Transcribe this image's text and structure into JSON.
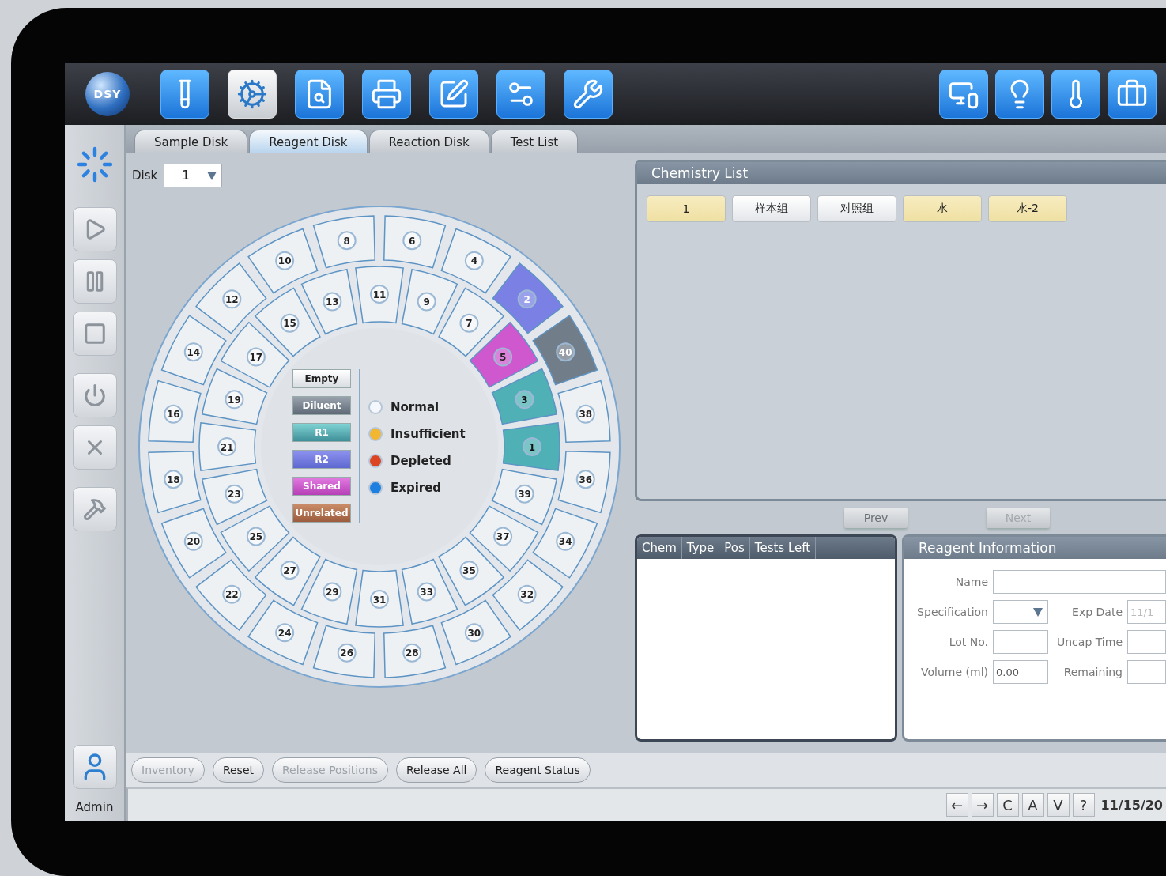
{
  "logo": {
    "text": "DSY"
  },
  "toolbar": [
    {
      "selected": false
    },
    {
      "selected": true
    },
    {
      "selected": false
    },
    {
      "selected": false
    },
    {
      "selected": false
    },
    {
      "selected": false
    },
    {
      "selected": false
    }
  ],
  "sidebar": {
    "user": "Admin"
  },
  "tabs": [
    {
      "label": "Sample Disk",
      "selected": false
    },
    {
      "label": "Reagent Disk",
      "selected": true
    },
    {
      "label": "Reaction Disk",
      "selected": false
    },
    {
      "label": "Test List",
      "selected": false
    }
  ],
  "disk": {
    "label": "Disk",
    "value": "1",
    "outer_ring": [
      {
        "number": "6",
        "kind": "empty"
      },
      {
        "number": "4",
        "kind": "empty"
      },
      {
        "number": "2",
        "kind": "r2"
      },
      {
        "number": "40",
        "kind": "diluent"
      },
      {
        "number": "38",
        "kind": "empty"
      },
      {
        "number": "36",
        "kind": "empty"
      },
      {
        "number": "34",
        "kind": "empty"
      },
      {
        "number": "32",
        "kind": "empty"
      },
      {
        "number": "30",
        "kind": "empty"
      },
      {
        "number": "28",
        "kind": "empty"
      },
      {
        "number": "26",
        "kind": "empty"
      },
      {
        "number": "24",
        "kind": "empty"
      },
      {
        "number": "22",
        "kind": "empty"
      },
      {
        "number": "20",
        "kind": "empty"
      },
      {
        "number": "18",
        "kind": "empty"
      },
      {
        "number": "16",
        "kind": "empty"
      },
      {
        "number": "14",
        "kind": "empty"
      },
      {
        "number": "12",
        "kind": "empty"
      },
      {
        "number": "10",
        "kind": "empty"
      },
      {
        "number": "8",
        "kind": "empty"
      }
    ],
    "inner_ring": [
      {
        "number": "11",
        "kind": "empty"
      },
      {
        "number": "9",
        "kind": "empty"
      },
      {
        "number": "7",
        "kind": "empty"
      },
      {
        "number": "5",
        "kind": "shared"
      },
      {
        "number": "3",
        "kind": "r1"
      },
      {
        "number": "1",
        "kind": "r1"
      },
      {
        "number": "39",
        "kind": "empty"
      },
      {
        "number": "37",
        "kind": "empty"
      },
      {
        "number": "35",
        "kind": "empty"
      },
      {
        "number": "33",
        "kind": "empty"
      },
      {
        "number": "31",
        "kind": "empty"
      },
      {
        "number": "29",
        "kind": "empty"
      },
      {
        "number": "27",
        "kind": "empty"
      },
      {
        "number": "25",
        "kind": "empty"
      },
      {
        "number": "23",
        "kind": "empty"
      },
      {
        "number": "21",
        "kind": "empty"
      },
      {
        "number": "19",
        "kind": "empty"
      },
      {
        "number": "17",
        "kind": "empty"
      },
      {
        "number": "15",
        "kind": "empty"
      },
      {
        "number": "13",
        "kind": "empty"
      }
    ],
    "type_legend": [
      {
        "label": "Empty",
        "kind": "empty"
      },
      {
        "label": "Diluent",
        "kind": "diluent"
      },
      {
        "label": "R1",
        "kind": "r1"
      },
      {
        "label": "R2",
        "kind": "r2"
      },
      {
        "label": "Shared",
        "kind": "shared"
      },
      {
        "label": "Unrelated",
        "kind": "unrelated"
      }
    ],
    "status_legend": [
      {
        "label": "Normal",
        "color": "#f4f8fc"
      },
      {
        "label": "Insufficient",
        "color": "#f2b630"
      },
      {
        "label": "Depleted",
        "color": "#dd4422"
      },
      {
        "label": "Expired",
        "color": "#1d7fe0"
      }
    ]
  },
  "chemistry_list": {
    "title": "Chemistry List",
    "items": [
      {
        "label": "1",
        "highlighted": true
      },
      {
        "label": "样本组",
        "highlighted": false
      },
      {
        "label": "对照组",
        "highlighted": false
      },
      {
        "label": "水",
        "highlighted": true
      },
      {
        "label": "水-2",
        "highlighted": true
      }
    ],
    "pager": [
      {
        "label": "Prev",
        "disabled": false
      },
      {
        "label": "Next",
        "disabled": true
      }
    ]
  },
  "reagent_table": {
    "columns": [
      "Chem",
      "Type",
      "Pos",
      "Tests Left"
    ]
  },
  "reagent_information": {
    "title": "Reagent Information",
    "name": {
      "label": "Name"
    },
    "specification": {
      "label": "Specification"
    },
    "exp_date": {
      "label": "Exp Date",
      "placeholder": "11/1"
    },
    "lot_no": {
      "label": "Lot No."
    },
    "uncap_time": {
      "label": "Uncap Time"
    },
    "volume": {
      "label": "Volume (ml)",
      "value": "0.00"
    },
    "remaining": {
      "label": "Remaining"
    }
  },
  "actions": [
    {
      "label": "Inventory",
      "disabled": true
    },
    {
      "label": "Reset",
      "disabled": false
    },
    {
      "label": "Release Positions",
      "disabled": true
    },
    {
      "label": "Release All",
      "disabled": false
    },
    {
      "label": "Reagent Status",
      "disabled": false
    }
  ],
  "status_bar": {
    "keys": [
      "←",
      "→",
      "C",
      "A",
      "V",
      "?"
    ],
    "date": "11/15/20"
  }
}
